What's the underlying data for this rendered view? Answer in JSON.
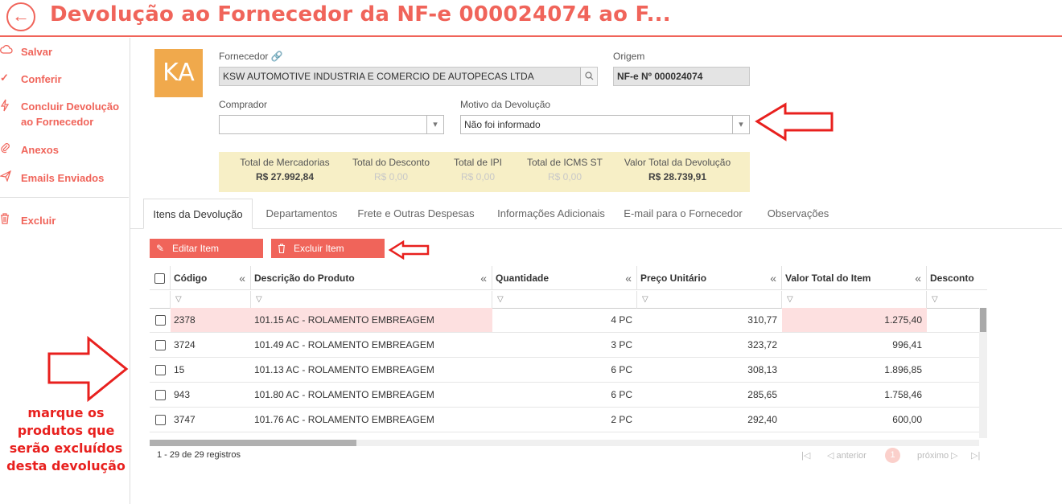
{
  "header": {
    "back_icon": "arrow-left-icon",
    "title": "Devolução ao Fornecedor da NF-e 000024074 ao F..."
  },
  "sidebar": {
    "items": [
      {
        "label": "Salvar",
        "icon": "cloud-icon"
      },
      {
        "label": "Conferir",
        "icon": "check-icon"
      },
      {
        "label": "Concluir Devolução ao Fornecedor",
        "icon": "lightning-icon"
      },
      {
        "label": "Anexos",
        "icon": "paperclip-icon"
      },
      {
        "label": "Emails Enviados",
        "icon": "send-icon"
      },
      {
        "label": "Excluir",
        "icon": "trash-icon"
      }
    ]
  },
  "avatar": {
    "initials": "KA"
  },
  "form": {
    "fornecedor_label": "Fornecedor",
    "fornecedor_value": "KSW AUTOMOTIVE INDUSTRIA E COMERCIO DE AUTOPECAS LTDA",
    "origem_label": "Origem",
    "origem_value": "NF-e Nº 000024074",
    "comprador_label": "Comprador",
    "comprador_value": "",
    "motivo_label": "Motivo da Devolução",
    "motivo_value": "Não foi informado"
  },
  "totals": [
    {
      "label": "Total de Mercadorias",
      "value": "R$ 27.992,84",
      "dim": false
    },
    {
      "label": "Total do Desconto",
      "value": "R$ 0,00",
      "dim": true
    },
    {
      "label": "Total de IPI",
      "value": "R$ 0,00",
      "dim": true
    },
    {
      "label": "Total de ICMS ST",
      "value": "R$ 0,00",
      "dim": true
    },
    {
      "label": "Valor Total da Devolução",
      "value": "R$ 28.739,91",
      "dim": false
    }
  ],
  "tabs": [
    "Itens da Devolução",
    "Departamentos",
    "Frete e Outras Despesas",
    "Informações Adicionais",
    "E-mail para o Fornecedor",
    "Observações"
  ],
  "actions": {
    "edit_label": "Editar Item",
    "delete_label": "Excluir Item"
  },
  "grid": {
    "columns": [
      "Código",
      "Descrição do Produto",
      "Quantidade",
      "Preço Unitário",
      "Valor Total do Item",
      "Desconto"
    ],
    "rows": [
      {
        "codigo": "2378",
        "descricao": "101.15 AC - ROLAMENTO EMBREAGEM",
        "quantidade": "4 PC",
        "preco": "310,77",
        "total": "1.275,40",
        "highlight": true
      },
      {
        "codigo": "3724",
        "descricao": "101.49 AC - ROLAMENTO EMBREAGEM",
        "quantidade": "3 PC",
        "preco": "323,72",
        "total": "996,41",
        "highlight": false
      },
      {
        "codigo": "15",
        "descricao": "101.13 AC - ROLAMENTO EMBREAGEM",
        "quantidade": "6 PC",
        "preco": "308,13",
        "total": "1.896,85",
        "highlight": false
      },
      {
        "codigo": "943",
        "descricao": "101.80 AC - ROLAMENTO EMBREAGEM",
        "quantidade": "6 PC",
        "preco": "285,65",
        "total": "1.758,46",
        "highlight": false
      },
      {
        "codigo": "3747",
        "descricao": "101.76 AC - ROLAMENTO EMBREAGEM",
        "quantidade": "2 PC",
        "preco": "292,40",
        "total": "600,00",
        "highlight": false
      }
    ],
    "footer_count": "1 - 29 de 29 registros"
  },
  "pager": {
    "prev": "anterior",
    "page": "1",
    "next": "próximo"
  },
  "annotation": "marque os produtos que serão excluídos desta devolução",
  "colors": {
    "accent": "#f0645a",
    "annotation": "#e8201e",
    "totals_bg": "#f7efc6",
    "row_highlight": "#fde0e0"
  }
}
